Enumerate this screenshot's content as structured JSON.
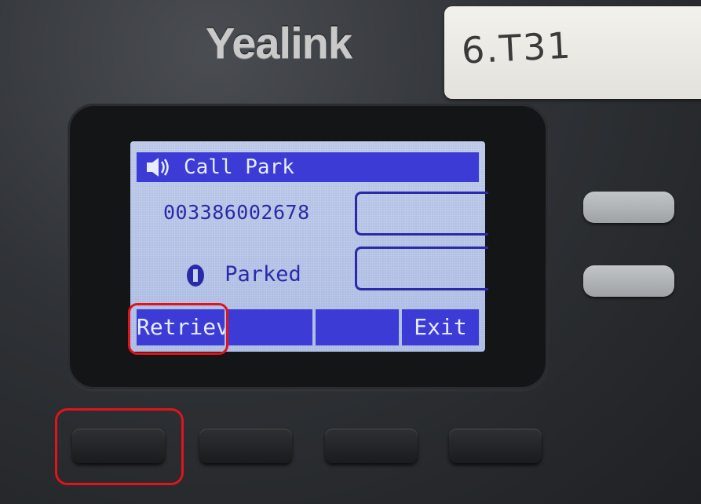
{
  "brand": "Yealink",
  "sticker_label": "6.T31",
  "screen": {
    "title": "Call Park",
    "title_icon": "speaker-icon",
    "number": "003386002678",
    "status": "Parked",
    "status_icon": "hold-icon"
  },
  "softkeys": [
    "Retriev",
    "",
    "",
    "Exit"
  ],
  "colors": {
    "lcd_background": "#c0ccf0",
    "lcd_highlight": "#3c3bd6",
    "lcd_text": "#2a2aa8",
    "annotation_red": "#e0141c"
  }
}
